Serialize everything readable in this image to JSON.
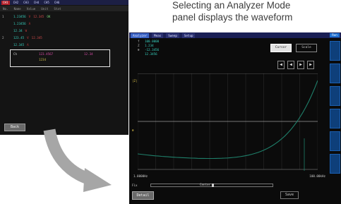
{
  "caption": {
    "line1": "Selecting an Analyzer Mode",
    "line2": "panel displays the waveform"
  },
  "list_screen": {
    "tabs": [
      "CH1",
      "CH2",
      "CH3",
      "CH4",
      "CH5",
      "CH6"
    ],
    "header": [
      "No.",
      "Name",
      "Value",
      "Unit",
      "Stat"
    ],
    "rows": [
      {
        "ch": "1",
        "val": "1.23456",
        "unit": "V",
        "c2": "12.345",
        "c3": "OK"
      },
      {
        "ch": "",
        "val": "1.23456",
        "unit": "A",
        "c2": "",
        "c3": ""
      },
      {
        "ch": "",
        "val": "12.34",
        "unit": "W",
        "c2": "",
        "c3": ""
      },
      {
        "ch": "2",
        "val": "123.45",
        "unit": "V",
        "c2": "12.345",
        "c3": ""
      },
      {
        "ch": "",
        "val": "12.345",
        "unit": "A",
        "c2": "",
        "c3": ""
      }
    ],
    "selected": {
      "name": "Ch",
      "v1": "123.4567",
      "v2": "12.34",
      "sub": "1234"
    },
    "button": "Back"
  },
  "wave_screen": {
    "tabs": [
      "Analyzer",
      "Meas",
      "Sweep",
      "Setup"
    ],
    "right_tab": "Run",
    "readouts": [
      {
        "k": "f",
        "v": "100.0000"
      },
      {
        "k": "Z",
        "v": "1.234"
      },
      {
        "k": "θ",
        "v": "-12.3456"
      },
      {
        "k": "",
        "v": "12.3456"
      }
    ],
    "btn_primary": "Cursor",
    "btn_secondary": "Scale",
    "arrows": [
      "◀",
      "◀",
      "▶",
      "▶"
    ],
    "y_label": "|Z|",
    "y_label2": "θ",
    "x_start": "1.0000Hz",
    "x_end": "100.00kHz",
    "bottom_left": "Fix",
    "bottom_center": "Center",
    "bottom_button": "Detail",
    "bottom_right_button": "Save",
    "colors": {
      "trace": "#1f7f6a",
      "grid": "#2a2a2a",
      "axis_text": "#e0c54a",
      "accent": "#3a63c4"
    }
  },
  "transition_arrow": {
    "color": "#a6a6a6",
    "icon": "curved-arrow"
  }
}
